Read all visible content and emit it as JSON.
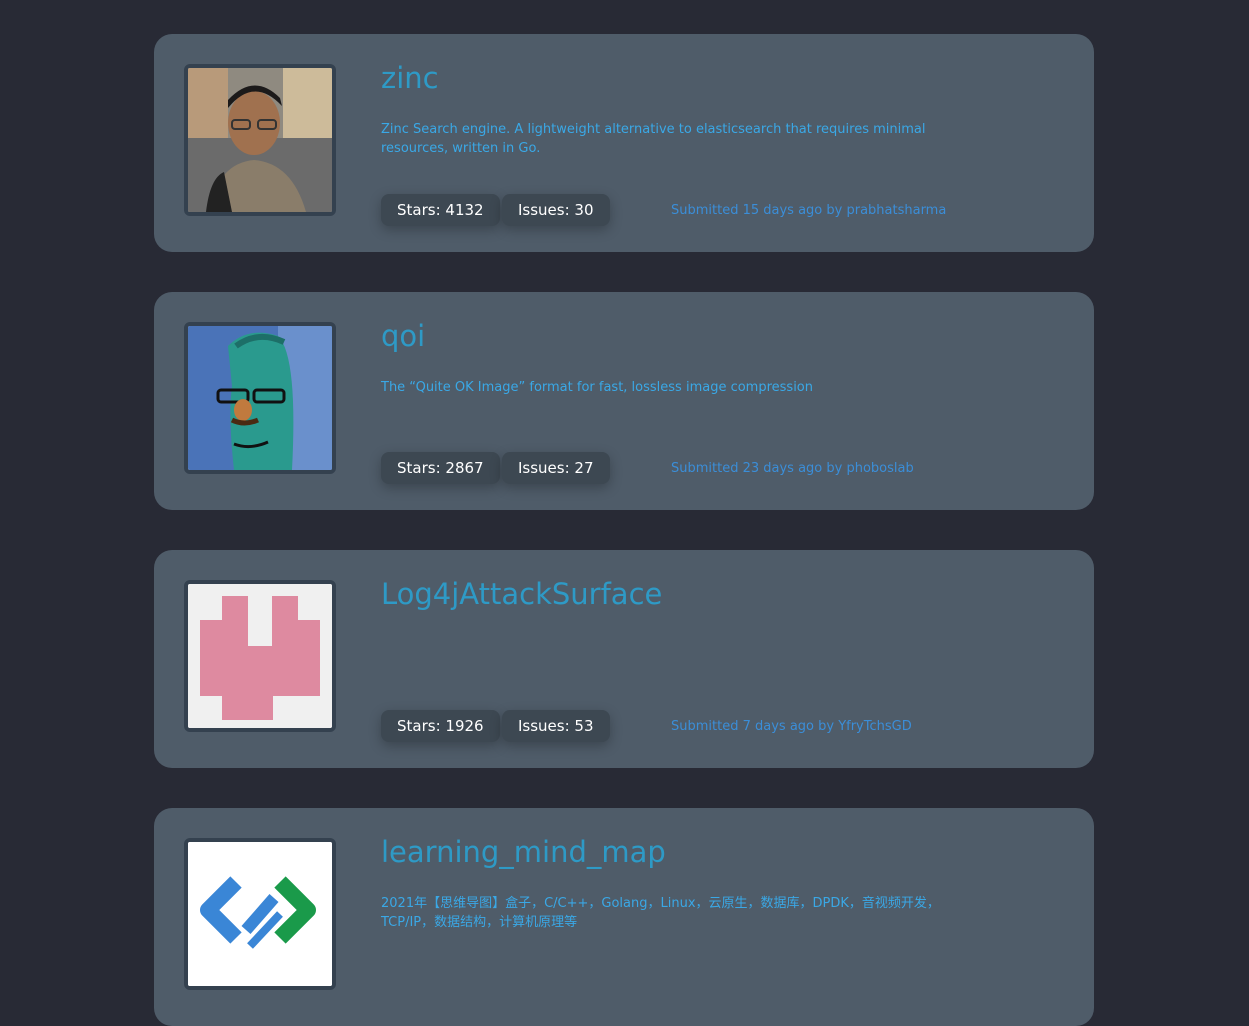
{
  "repos": [
    {
      "name": "zinc",
      "description": "Zinc Search engine. A lightweight alternative to elasticsearch that requires minimal resources, written in Go.",
      "stars": "Stars: 4132",
      "issues": "Issues: 30",
      "submitted": "Submitted 15 days ago by prabhatsharma"
    },
    {
      "name": "qoi",
      "description": "The “Quite OK Image” format for fast, lossless image compression",
      "stars": "Stars: 2867",
      "issues": "Issues: 27",
      "submitted": "Submitted 23 days ago by phoboslab"
    },
    {
      "name": "Log4jAttackSurface",
      "description": "",
      "stars": "Stars: 1926",
      "issues": "Issues: 53",
      "submitted": "Submitted 7 days ago by YfryTchsGD"
    },
    {
      "name": "learning_mind_map",
      "description": "2021年【思维导图】盒子，C/C++，Golang，Linux，云原生，数据库，DPDK，音视频开发，TCP/IP，数据结构，计算机原理等",
      "stars": "",
      "issues": "",
      "submitted": ""
    }
  ]
}
